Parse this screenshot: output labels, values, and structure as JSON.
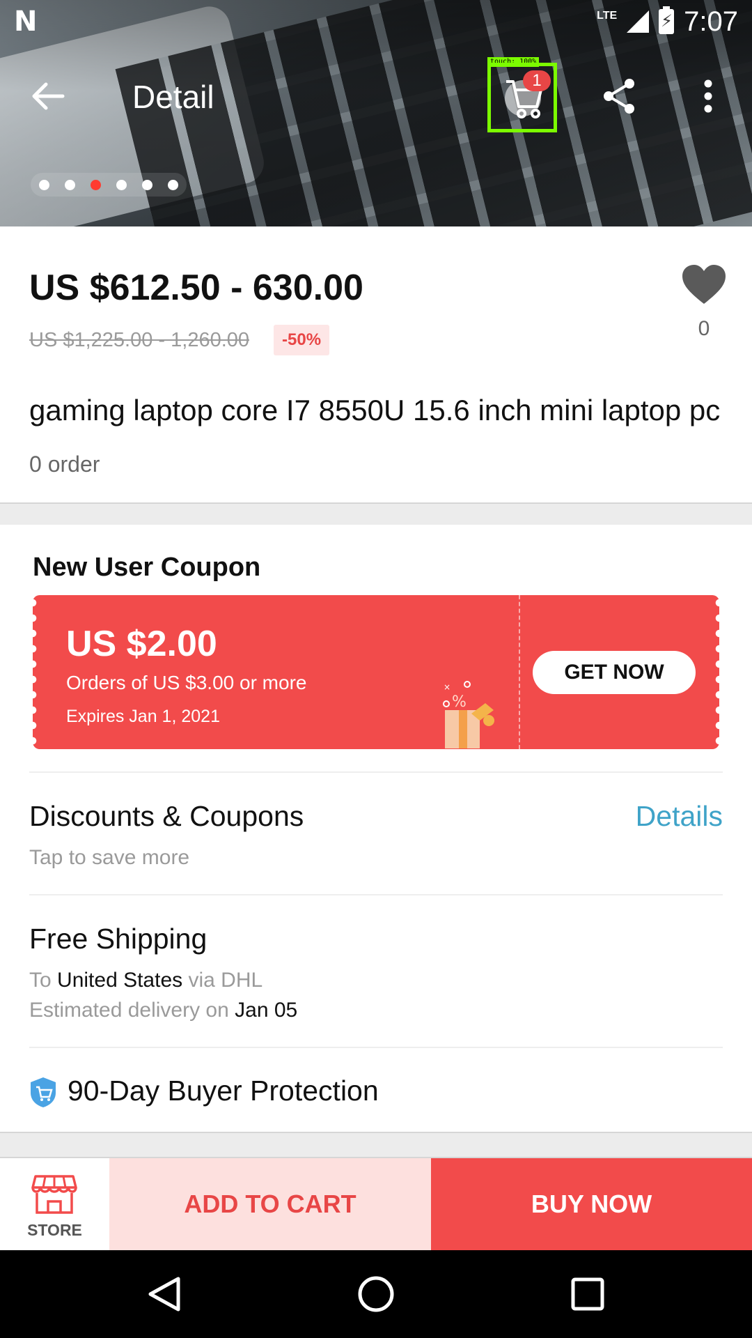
{
  "status_bar": {
    "network": "LTE",
    "time": "7:07"
  },
  "toolbar": {
    "title": "Detail",
    "cart_count": "1",
    "touch_label": "touch: 100%"
  },
  "carousel": {
    "count": 6,
    "active_index": 2
  },
  "product": {
    "price": "US $612.50 - 630.00",
    "original_price": "US $1,225.00 - 1,260.00",
    "discount": "-50%",
    "favorites": "0",
    "title": "gaming laptop core I7 8550U 15.6 inch mini laptop pc",
    "orders": "0 order"
  },
  "coupon": {
    "heading": "New User Coupon",
    "amount": "US $2.00",
    "condition": "Orders of US $3.00 or more",
    "expires": "Expires Jan 1, 2021",
    "button": "GET NOW"
  },
  "discounts": {
    "title": "Discounts & Coupons",
    "subtitle": "Tap to save more",
    "link": "Details"
  },
  "shipping": {
    "title": "Free Shipping",
    "to_prefix": "To",
    "country": "United States",
    "via": "via DHL",
    "delivery_prefix": "Estimated delivery on",
    "date": "Jan 05"
  },
  "protection": {
    "title": "90-Day Buyer Protection"
  },
  "actions": {
    "store": "STORE",
    "add_to_cart": "ADD TO CART",
    "buy_now": "BUY NOW"
  },
  "colors": {
    "accent_red": "#f24b4b",
    "link_blue": "#3fa3c8",
    "highlight_green": "#7cfc00"
  }
}
